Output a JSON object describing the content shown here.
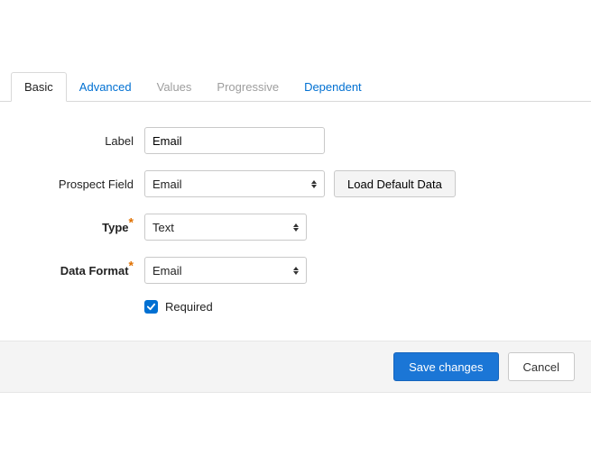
{
  "tabs": {
    "basic": "Basic",
    "advanced": "Advanced",
    "values": "Values",
    "progressive": "Progressive",
    "dependent": "Dependent"
  },
  "form": {
    "label_label": "Label",
    "label_value": "Email",
    "prospect_label": "Prospect Field",
    "prospect_value": "Email",
    "load_default_btn": "Load Default Data",
    "type_label": "Type",
    "type_value": "Text",
    "format_label": "Data Format",
    "format_value": "Email",
    "required_label": "Required",
    "required_checked": true
  },
  "footer": {
    "save": "Save changes",
    "cancel": "Cancel"
  }
}
